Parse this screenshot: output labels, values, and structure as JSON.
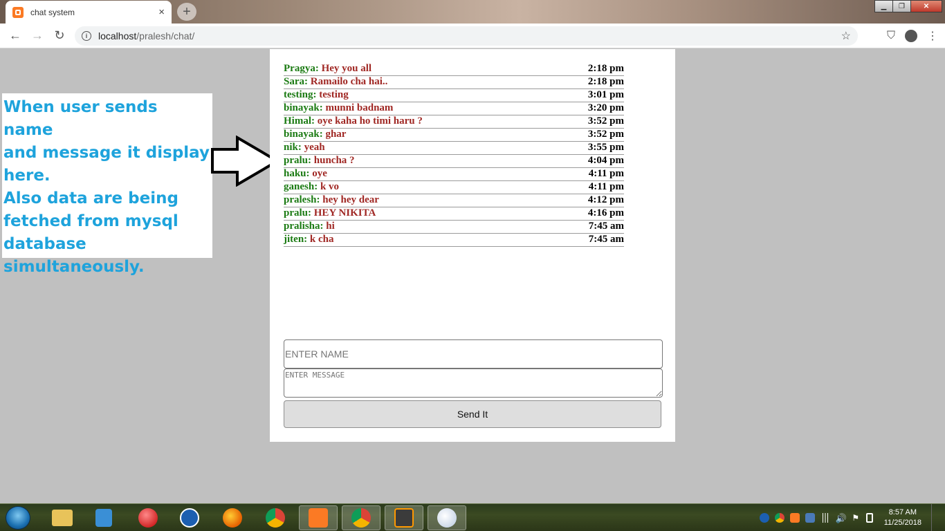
{
  "browser": {
    "tab_title": "chat system",
    "tab_close": "×",
    "new_tab": "+",
    "url_host": "localhost",
    "url_path": "/pralesh/chat/",
    "win_min": "▁",
    "win_max": "❐",
    "win_close": "✕"
  },
  "annotation": {
    "text": "When user sends name\nand message it display\nhere.\nAlso data are being\nfetched from mysql\ndatabase simultaneously."
  },
  "messages": [
    {
      "name": "Pragya",
      "text": "Hey you all",
      "time": "2:18 pm"
    },
    {
      "name": "Sara",
      "text": "Ramailo cha hai..",
      "time": "2:18 pm"
    },
    {
      "name": "testing",
      "text": "testing",
      "time": "3:01 pm"
    },
    {
      "name": "binayak",
      "text": "munni badnam",
      "time": "3:20 pm"
    },
    {
      "name": "Himal",
      "text": "oye kaha ho timi haru ?",
      "time": "3:52 pm"
    },
    {
      "name": "binayak",
      "text": "ghar",
      "time": "3:52 pm"
    },
    {
      "name": "nik",
      "text": "yeah",
      "time": "3:55 pm"
    },
    {
      "name": "pralu",
      "text": "huncha ?",
      "time": "4:04 pm"
    },
    {
      "name": "haku",
      "text": "oye",
      "time": "4:11 pm"
    },
    {
      "name": "ganesh",
      "text": "k vo",
      "time": "4:11 pm"
    },
    {
      "name": "pralesh",
      "text": "hey hey dear",
      "time": "4:12 pm"
    },
    {
      "name": "pralu",
      "text": "HEY NIKITA",
      "time": "4:16 pm"
    },
    {
      "name": "pralisha",
      "text": "hi",
      "time": "7:45 am"
    },
    {
      "name": "jiten",
      "text": "k cha",
      "time": "7:45 am"
    }
  ],
  "form": {
    "name_placeholder": "ENTER NAME",
    "message_placeholder": "ENTER MESSAGE",
    "send_label": "Send It"
  },
  "taskbar": {
    "time": "8:57 AM",
    "date": "11/25/2018"
  },
  "colors": {
    "name": "#1a7a12",
    "message": "#a02824",
    "annotation": "#1ea3dc"
  }
}
